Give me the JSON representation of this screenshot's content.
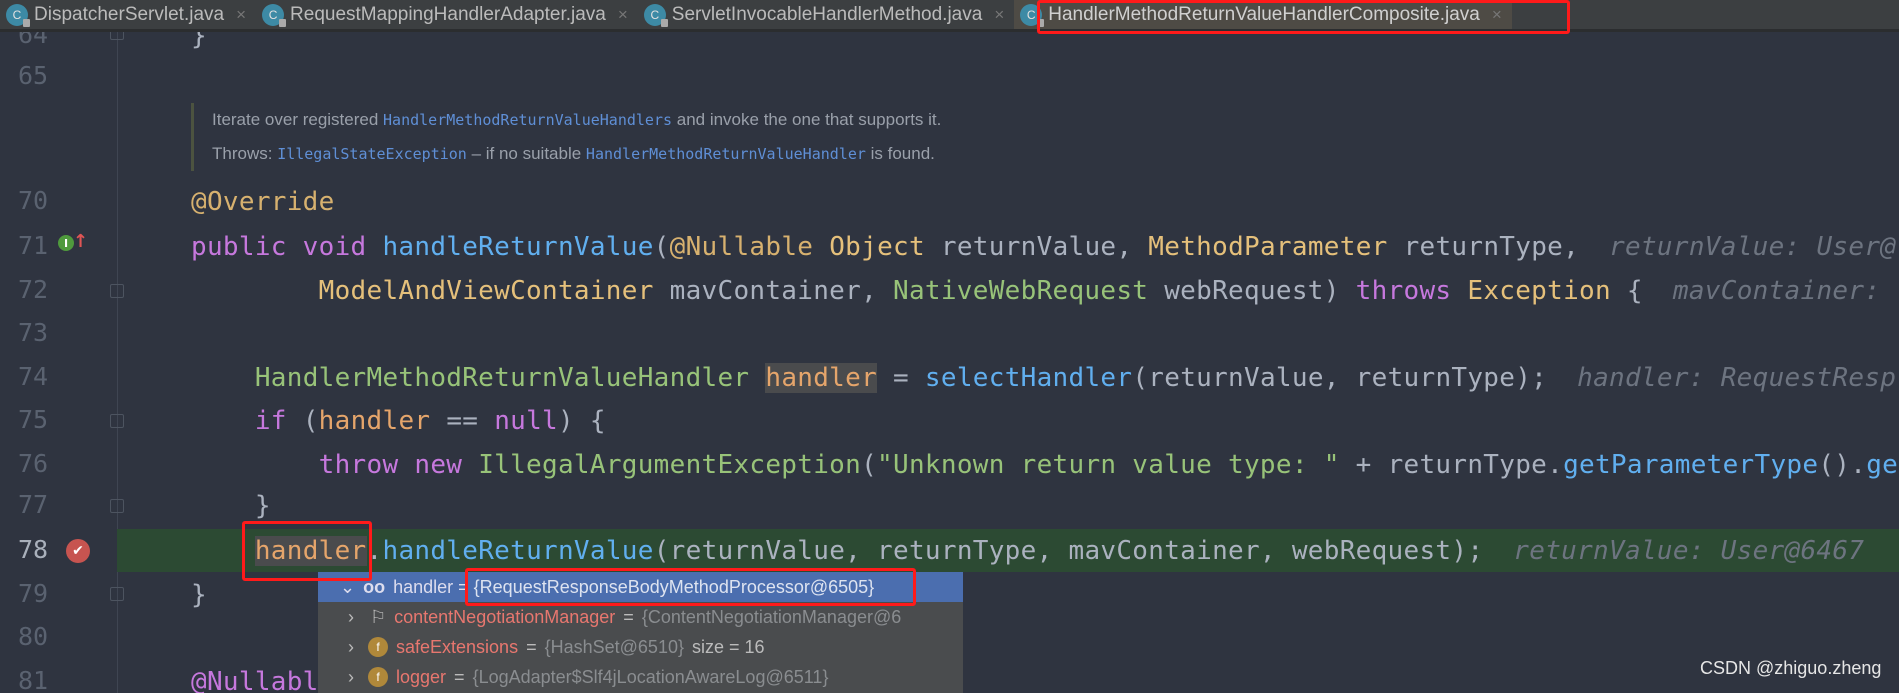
{
  "tabs": [
    {
      "label": "DispatcherServlet.java",
      "active": false
    },
    {
      "label": "RequestMappingHandlerAdapter.java",
      "active": false
    },
    {
      "label": "ServletInvocableHandlerMethod.java",
      "active": false
    },
    {
      "label": "HandlerMethodReturnValueHandlerComposite.java",
      "active": true
    }
  ],
  "gutter": {
    "line_numbers": [
      "64",
      "65",
      "70",
      "71",
      "72",
      "73",
      "74",
      "75",
      "76",
      "77",
      "78",
      "79",
      "80",
      "81"
    ],
    "icons": [
      "implements-method-icon",
      "breakpoint-icon"
    ]
  },
  "doc": {
    "line1": [
      "Iterate over registered ",
      "HandlerMethodReturnValueHandlers",
      " and invoke the one that supports it."
    ],
    "line2": [
      "Throws: ",
      "IllegalStateException",
      " – if no suitable ",
      "HandlerMethodReturnValueHandler",
      " is found."
    ]
  },
  "code": [
    {
      "n": "64",
      "t": [
        [
          "p",
          "}"
        ]
      ]
    },
    {
      "n": "65",
      "t": []
    },
    {
      "n": "70",
      "t": [
        [
          "an",
          "@Override"
        ]
      ]
    },
    {
      "n": "71",
      "t": [
        [
          "kw",
          "public void "
        ],
        [
          "fn",
          "handleReturnValue"
        ],
        [
          "p",
          "("
        ],
        [
          "an",
          "@Nullable"
        ],
        [
          "p",
          " "
        ],
        [
          "ty",
          "Object"
        ],
        [
          "p",
          " returnValue, "
        ],
        [
          "ty",
          "MethodParameter"
        ],
        [
          "p",
          " returnType,"
        ],
        [
          "hint",
          "returnValue: User@"
        ]
      ]
    },
    {
      "n": "72",
      "t": [
        [
          "p",
          "        "
        ],
        [
          "ty",
          "ModelAndViewContainer"
        ],
        [
          "p",
          " mavContainer, "
        ],
        [
          "gr",
          "NativeWebRequest"
        ],
        [
          "p",
          " webRequest) "
        ],
        [
          "kw",
          "throws"
        ],
        [
          "p",
          " "
        ],
        [
          "ty",
          "Exception"
        ],
        [
          "p",
          " {"
        ],
        [
          "hint",
          "mavContainer: "
        ]
      ]
    },
    {
      "n": "73",
      "t": []
    },
    {
      "n": "74",
      "t": [
        [
          "p",
          "    "
        ],
        [
          "gr",
          "HandlerMethodReturnValueHandler"
        ],
        [
          "p",
          " "
        ],
        [
          "vah",
          "handler"
        ],
        [
          "p",
          " = "
        ],
        [
          "fn",
          "selectHandler"
        ],
        [
          "p",
          "(returnValue, returnType);"
        ],
        [
          "hint",
          "handler: RequestResp"
        ]
      ]
    },
    {
      "n": "75",
      "t": [
        [
          "p",
          "    "
        ],
        [
          "kw",
          "if"
        ],
        [
          "p",
          " ("
        ],
        [
          "va",
          "handler"
        ],
        [
          "p",
          " == "
        ],
        [
          "kw",
          "null"
        ],
        [
          "p",
          ") {"
        ]
      ]
    },
    {
      "n": "76",
      "t": [
        [
          "p",
          "        "
        ],
        [
          "kw",
          "throw new "
        ],
        [
          "gr",
          "IllegalArgumentException"
        ],
        [
          "p",
          "("
        ],
        [
          "st",
          "\"Unknown return value type: \""
        ],
        [
          "p",
          " + returnType."
        ],
        [
          "fn",
          "getParameterType"
        ],
        [
          "p",
          "()."
        ],
        [
          "fn",
          "ge"
        ]
      ]
    },
    {
      "n": "77",
      "t": [
        [
          "p",
          "    }"
        ]
      ]
    },
    {
      "n": "78",
      "t": [
        [
          "p",
          "    "
        ],
        [
          "vah",
          "handler"
        ],
        [
          "p",
          "."
        ],
        [
          "fn",
          "handleReturnValue"
        ],
        [
          "p",
          "(returnValue, returnType, mavContainer, webRequest);"
        ],
        [
          "hint",
          "returnValue: User@6467"
        ]
      ]
    },
    {
      "n": "79",
      "t": [
        [
          "p",
          "}"
        ]
      ]
    },
    {
      "n": "80",
      "t": []
    },
    {
      "n": "81",
      "t": [
        [
          "an2",
          "@Nullabl"
        ]
      ]
    }
  ],
  "popup": {
    "root": {
      "name": "handler",
      "eq": " = ",
      "value": "{RequestResponseBodyMethodProcessor@6505}"
    },
    "children": [
      {
        "icon": "flag-icon",
        "name": "contentNegotiationManager",
        "value": "{ContentNegotiationManager@6",
        "extra": ""
      },
      {
        "icon": "field-icon",
        "name": "safeExtensions",
        "value": "{HashSet@6510}",
        "extra": "size = 16"
      },
      {
        "icon": "field-icon",
        "name": "logger",
        "value": "{LogAdapter$Slf4jLocationAwareLog@6511}",
        "extra": ""
      }
    ]
  },
  "watermark": "CSDN @zhiguo.zheng",
  "colors": {
    "background": "#2f3440",
    "current_line": "#2c4a33",
    "selection": "#4b6eaf",
    "annotation_box": "#ff1a1a"
  }
}
